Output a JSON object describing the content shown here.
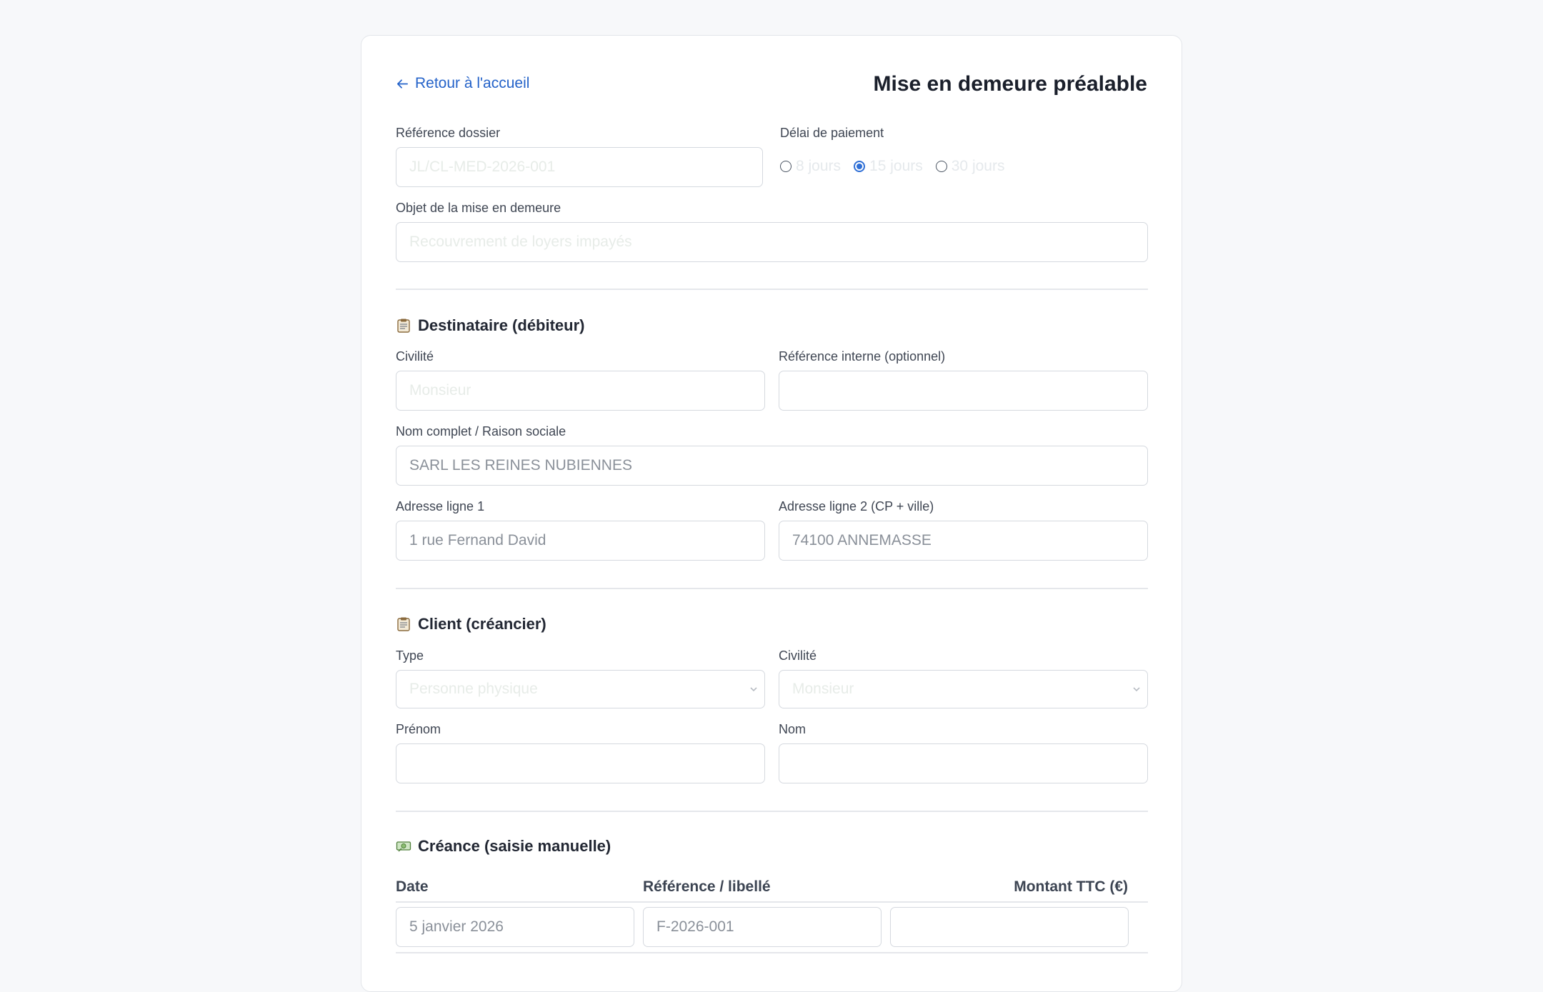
{
  "header": {
    "back_label": "Retour à l'accueil",
    "title": "Mise en demeure préalable"
  },
  "general": {
    "ref_label": "Référence dossier",
    "ref_placeholder": "JL/CL-MED-2026-001",
    "delay_label": "Délai de paiement",
    "delay_options": [
      "8 jours",
      "15 jours",
      "30 jours"
    ],
    "delay_selected": "15 jours",
    "object_label": "Objet de la mise en demeure",
    "object_placeholder": "Recouvrement de loyers impayés"
  },
  "debtor": {
    "title": "Destinataire (débiteur)",
    "icon": "clipboard-icon",
    "civility_label": "Civilité",
    "civility_placeholder": "Monsieur",
    "internal_ref_label": "Référence interne (optionnel)",
    "internal_ref_value": "",
    "name_label": "Nom complet / Raison sociale",
    "name_value": "SARL LES REINES NUBIENNES",
    "address1_label": "Adresse ligne 1",
    "address1_value": "1 rue Fernand David",
    "address2_label": "Adresse ligne 2 (CP + ville)",
    "address2_value": "74100 ANNEMASSE"
  },
  "client": {
    "title": "Client (créancier)",
    "icon": "clipboard-icon",
    "type_label": "Type",
    "type_value": "Personne physique",
    "civility_label": "Civilité",
    "civility_value": "Monsieur",
    "firstname_label": "Prénom",
    "firstname_value": "",
    "lastname_label": "Nom",
    "lastname_value": ""
  },
  "claim": {
    "title": "Créance (saisie manuelle)",
    "icon": "banknote-icon",
    "columns": [
      "Date",
      "Référence / libellé",
      "Montant TTC (€)"
    ],
    "rows": [
      {
        "date": "5 janvier 2026",
        "reference": "F-2026-001",
        "amount": ""
      }
    ]
  },
  "colors": {
    "link": "#2563c9",
    "radio_selected": "#2f6fd6",
    "background": "#f7f8fa",
    "card": "#ffffff"
  }
}
